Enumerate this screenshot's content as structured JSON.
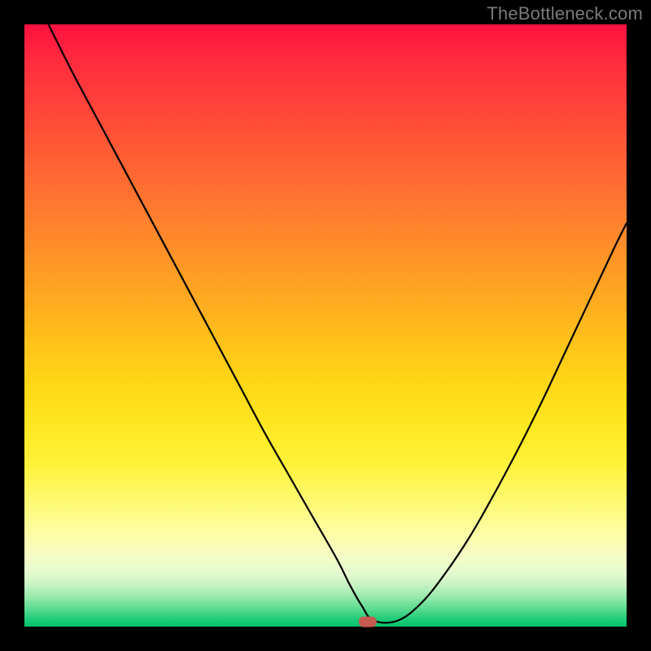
{
  "watermark": "TheBottleneck.com",
  "chart_data": {
    "type": "line",
    "title": "",
    "xlabel": "",
    "ylabel": "",
    "xlim": [
      0,
      100
    ],
    "ylim": [
      0,
      100
    ],
    "grid": false,
    "series": [
      {
        "name": "bottleneck-curve",
        "x": [
          4,
          8,
          12,
          16,
          20,
          24,
          28,
          32,
          36,
          40,
          44,
          48,
          52,
          54,
          56,
          58,
          62,
          66,
          70,
          74,
          78,
          82,
          86,
          90,
          94,
          98,
          100
        ],
        "y": [
          100,
          92,
          84.5,
          77,
          69.5,
          62,
          54.5,
          47,
          39.5,
          32,
          25,
          18,
          11,
          7,
          3.5,
          1,
          1,
          4,
          9,
          15,
          22,
          29.5,
          37.5,
          46,
          54.5,
          63,
          67
        ]
      }
    ],
    "marker": {
      "x": 57,
      "y": 0.8,
      "label": "optimal-point"
    },
    "gradient_stops": [
      {
        "pct": 0,
        "color": "#FF1140"
      },
      {
        "pct": 50,
        "color": "#FFC01C"
      },
      {
        "pct": 85,
        "color": "#FCFDA8"
      },
      {
        "pct": 100,
        "color": "#00C46B"
      }
    ]
  }
}
